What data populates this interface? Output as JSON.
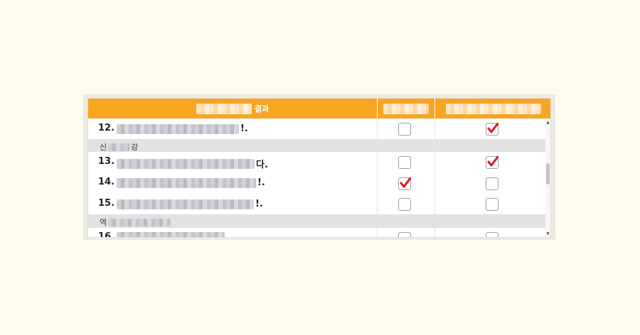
{
  "table": {
    "header": {
      "col1_suffix": "결과",
      "col2": "",
      "col3": ""
    },
    "rows": [
      {
        "kind": "item",
        "number": "12.",
        "text_end": "!.",
        "c2": false,
        "c3": true
      },
      {
        "kind": "cat",
        "prefix": "신",
        "suffix": "강"
      },
      {
        "kind": "item",
        "number": "13.",
        "text_end": "다.",
        "c2": false,
        "c3": true
      },
      {
        "kind": "item",
        "number": "14.",
        "text_end": "!.",
        "c2": true,
        "c3": false
      },
      {
        "kind": "item",
        "number": "15.",
        "text_end": "!.",
        "c2": false,
        "c3": false
      },
      {
        "kind": "cat",
        "prefix": "역",
        "suffix": ""
      },
      {
        "kind": "item",
        "number": "16.",
        "text_end": "",
        "c2": false,
        "c3": false
      }
    ],
    "scrollbar": {
      "position": 0.45
    }
  },
  "colors": {
    "header": "#f7a523",
    "check": "#e2151b",
    "category_row": "#e2e2e2"
  }
}
